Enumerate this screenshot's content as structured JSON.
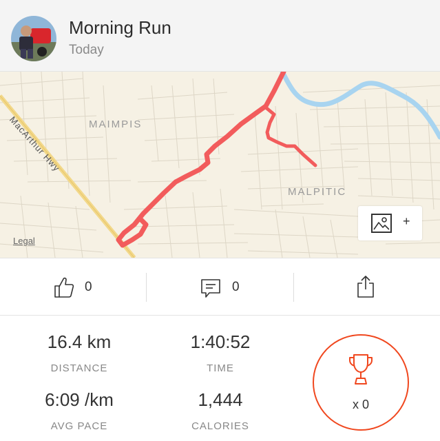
{
  "activity": {
    "title": "Morning Run",
    "date": "Today"
  },
  "map": {
    "labels": {
      "maimpis": "MAIMPIS",
      "malpitic": "MALPITIC",
      "road": "MacArthur Hwy"
    },
    "legal": "Legal",
    "add_photo": "+",
    "route_color": "#f25c5c"
  },
  "actions": {
    "kudos_count": "0",
    "comments_count": "0"
  },
  "stats": {
    "distance_value": "16.4 km",
    "distance_label": "DISTANCE",
    "time_value": "1:40:52",
    "time_label": "TIME",
    "pace_value": "6:09 /km",
    "pace_label": "AVG PACE",
    "calories_value": "1,444",
    "calories_label": "CALORIES"
  },
  "achievements": {
    "count": "x 0",
    "accent_color": "#f0471e"
  }
}
